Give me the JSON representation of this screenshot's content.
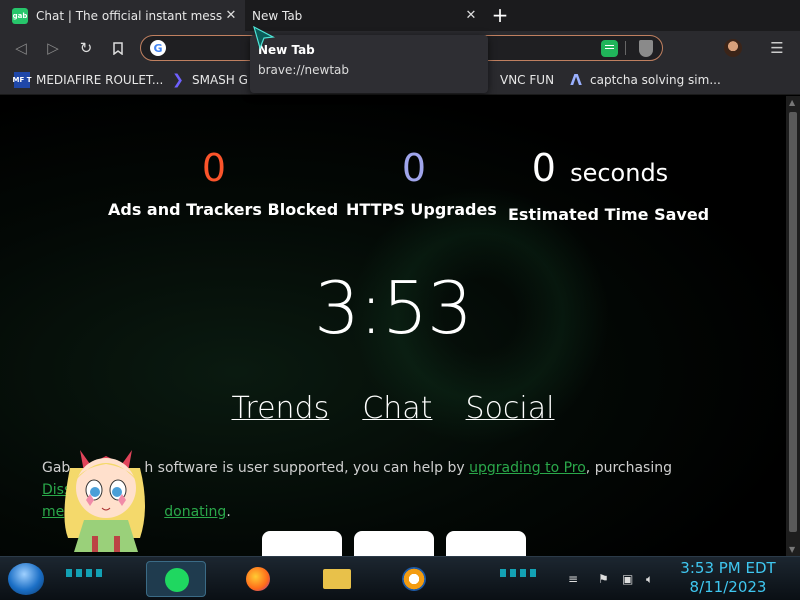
{
  "browser": {
    "tabs": [
      {
        "favicon_text": "gab",
        "title": "Chat | The official instant messaging",
        "close": "✕"
      },
      {
        "title": "New Tab",
        "close": "✕"
      }
    ],
    "new_tab_symbol": "+",
    "address_bar": {
      "value": "",
      "placeholder": ""
    },
    "bookmarks": [
      {
        "icon": "mediafire-icon",
        "icon_text": "MF T",
        "label": "MEDIAFIRE ROULET..."
      },
      {
        "icon": "smash-icon",
        "label": "SMASH G"
      },
      {
        "icon": "none",
        "label": "VNC FUN"
      },
      {
        "icon": "lambda-icon",
        "label": "captcha solving sim..."
      }
    ],
    "tooltip": {
      "title": "New Tab",
      "url": "brave://newtab"
    }
  },
  "newtab": {
    "stats": [
      {
        "value": "0",
        "label": "Ads and Trackers Blocked"
      },
      {
        "value": "0",
        "label": "HTTPS Upgrades"
      },
      {
        "value": "0",
        "unit": "seconds",
        "label": "Estimated Time Saved"
      }
    ],
    "clock": "3:53",
    "links": [
      "Trends",
      "Chat",
      "Social"
    ],
    "support_text": {
      "start": "Gab",
      "middle": "h software is user supported, you can help by ",
      "link1": "upgrading to Pro",
      "mid2": ", purchasing ",
      "link2": "Dissenter",
      "line2a": "me",
      "line2b": "donating",
      "end": "."
    }
  },
  "taskbar": {
    "time": "3:53 PM EDT",
    "date": "8/11/2023",
    "icons": [
      "start-orb-icon",
      "spotify-icon",
      "firefox-icon",
      "file-explorer-icon",
      "brave-icon"
    ]
  },
  "colors": {
    "ads": "#fb542b",
    "https": "#a0a5eb",
    "link_green": "#2aa84a",
    "clock_cyan": "#3fc7f0"
  }
}
